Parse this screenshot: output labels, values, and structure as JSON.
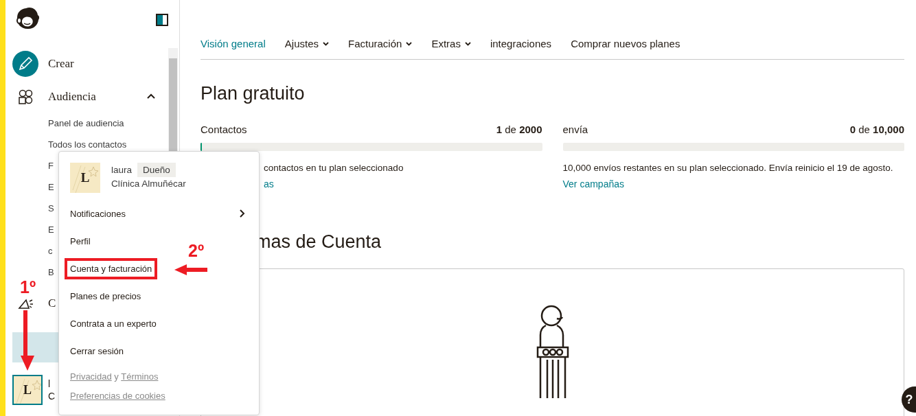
{
  "sidebar": {
    "items": [
      {
        "kind": "create",
        "label": "Crear"
      },
      {
        "kind": "audience",
        "label": "Audiencia",
        "expanded": true,
        "children": [
          {
            "label": "Panel de audiencia"
          },
          {
            "label": "Todos los contactos"
          },
          {
            "label": "F"
          },
          {
            "label": "E"
          },
          {
            "label": "S"
          },
          {
            "label": "E"
          },
          {
            "label": "c"
          },
          {
            "label": "B"
          }
        ]
      },
      {
        "kind": "campaigns",
        "label": "C"
      }
    ],
    "account": {
      "initial": "L",
      "name": "l",
      "org": "C"
    }
  },
  "tabs": [
    {
      "label": "Visión general",
      "selected": true,
      "dropdown": false
    },
    {
      "label": "Ajustes",
      "selected": false,
      "dropdown": true
    },
    {
      "label": "Facturación",
      "selected": false,
      "dropdown": true
    },
    {
      "label": "Extras",
      "selected": false,
      "dropdown": true
    },
    {
      "label": "integraciones",
      "selected": false,
      "dropdown": false
    },
    {
      "label": "Comprar nuevos planes",
      "selected": false,
      "dropdown": false
    }
  ],
  "plan_title": "Plan gratuito",
  "usage": [
    {
      "label": "Contactos",
      "count": "**1** de **2000**",
      "level": 0.0005,
      "note": "contactos en tu plan seleccionado",
      "link": "as"
    },
    {
      "label": "envía",
      "count": "**0** de **10,000**",
      "level": 0,
      "note": "10,000 envíos restantes en su plan seleccionado. Envía reinicio el 19 de agosto.",
      "link": "Ver campañas"
    }
  ],
  "issues_title": "mas de Cuenta",
  "account_menu": {
    "user": {
      "initial": "L",
      "name": "laura",
      "role": "Dueño",
      "org": "Clínica Almuñécar"
    },
    "items": [
      {
        "label": "Notificaciones",
        "submenu": true,
        "highlighted": false
      },
      {
        "label": "Perfil",
        "submenu": false,
        "highlighted": false
      },
      {
        "label": "Cuenta y facturación",
        "submenu": false,
        "highlighted": true
      },
      {
        "label": "Planes de precios",
        "submenu": false,
        "highlighted": false
      },
      {
        "label": "Contrata a un experto",
        "submenu": false,
        "highlighted": false
      },
      {
        "label": "Cerrar sesión",
        "submenu": false,
        "highlighted": false
      }
    ],
    "legal": {
      "privacy": "Privacidad",
      "joiner": "y",
      "terms": "Términos"
    },
    "cookies": "Preferencias de cookies"
  },
  "annotations": [
    {
      "kind": "down",
      "label": "1º"
    },
    {
      "kind": "left",
      "label": "2º"
    }
  ],
  "help": "?"
}
